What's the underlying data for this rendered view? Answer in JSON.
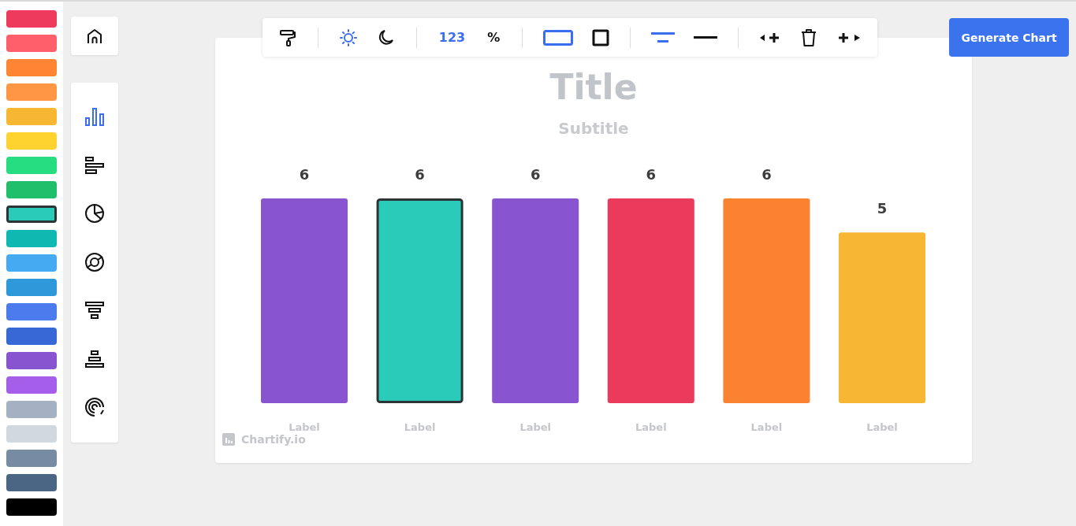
{
  "palette": [
    {
      "color": "#ee3a5c",
      "selected": false
    },
    {
      "color": "#fe5f6a",
      "selected": false
    },
    {
      "color": "#fd8533",
      "selected": false
    },
    {
      "color": "#fe9644",
      "selected": false
    },
    {
      "color": "#f7b733",
      "selected": false
    },
    {
      "color": "#fed330",
      "selected": false
    },
    {
      "color": "#26de81",
      "selected": false
    },
    {
      "color": "#20bf6b",
      "selected": false
    },
    {
      "color": "#2bcbba",
      "selected": true
    },
    {
      "color": "#0fb9b1",
      "selected": false
    },
    {
      "color": "#45aaf2",
      "selected": false
    },
    {
      "color": "#2d98da",
      "selected": false
    },
    {
      "color": "#4b7bec",
      "selected": false
    },
    {
      "color": "#3867d6",
      "selected": false
    },
    {
      "color": "#8854d0",
      "selected": false
    },
    {
      "color": "#a55eea",
      "selected": false
    },
    {
      "color": "#a5b1c2",
      "selected": false
    },
    {
      "color": "#d1d8e0",
      "selected": false
    },
    {
      "color": "#778ca3",
      "selected": false
    },
    {
      "color": "#4b6584",
      "selected": false
    },
    {
      "color": "#000000",
      "selected": false
    }
  ],
  "chart_types": [
    {
      "kind": "column",
      "selected": true
    },
    {
      "kind": "bar",
      "selected": false
    },
    {
      "kind": "pie",
      "selected": false
    },
    {
      "kind": "donut",
      "selected": false
    },
    {
      "kind": "funnel",
      "selected": false
    },
    {
      "kind": "pyramid",
      "selected": false
    },
    {
      "kind": "radial",
      "selected": false
    }
  ],
  "toolbar": {
    "theme": [
      {
        "kind": "light",
        "selected": true
      },
      {
        "kind": "dark",
        "selected": false
      }
    ],
    "value_format": [
      {
        "label": "123",
        "selected": true
      },
      {
        "label": "%",
        "selected": false
      }
    ],
    "border": [
      {
        "kind": "wide",
        "selected": true
      },
      {
        "kind": "square",
        "selected": false
      }
    ],
    "lines": [
      {
        "kind": "centered",
        "selected": true
      },
      {
        "kind": "single",
        "selected": false
      }
    ]
  },
  "generate_button": "Generate Chart",
  "chart": {
    "title": "Title",
    "subtitle": "Subtitle",
    "watermark": "Chartify.io",
    "bars": [
      {
        "color": "#8854d0",
        "selected": false
      },
      {
        "color": "#2bcbba",
        "selected": true
      },
      {
        "color": "#8854d0",
        "selected": false
      },
      {
        "color": "#eb3b5a",
        "selected": false
      },
      {
        "color": "#fa8231",
        "selected": false
      },
      {
        "color": "#f7b733",
        "selected": false
      }
    ],
    "chart_data": {
      "type": "bar",
      "categories": [
        "Label",
        "Label",
        "Label",
        "Label",
        "Label",
        "Label"
      ],
      "values": [
        6,
        6,
        6,
        6,
        6,
        5
      ],
      "ylim": [
        0,
        6
      ],
      "data_labels": true
    }
  }
}
